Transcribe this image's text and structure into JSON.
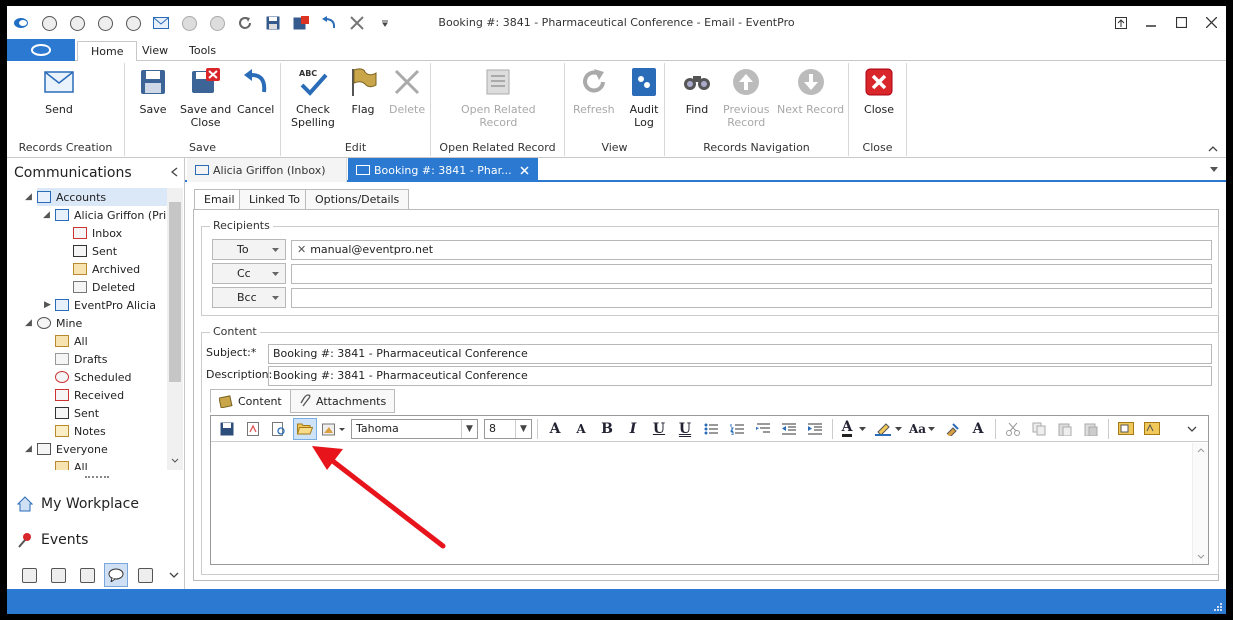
{
  "window": {
    "title": "Booking #: 3841 - Pharmaceutical Conference - Email - EventPro",
    "accent": "#2b79d0"
  },
  "qat": {
    "icons": [
      "back-icon",
      "clock-icon",
      "clock-icon",
      "clock-icon",
      "clock-icon",
      "envelope-icon",
      "up-circle-icon",
      "down-circle-icon",
      "refresh-icon",
      "save-icon",
      "save-close-icon",
      "undo-icon",
      "close-x-icon",
      "qat-dropdown-icon"
    ]
  },
  "ribbon_tabs": [
    "Home",
    "View",
    "Tools"
  ],
  "ribbon": {
    "groups": {
      "records_creation": "Records Creation",
      "save": "Save",
      "edit": "Edit",
      "open_related": "Open Related Record",
      "view": "View",
      "records_navigation": "Records Navigation",
      "close": "Close"
    },
    "buttons": {
      "send": "Send",
      "save": "Save",
      "save_close_1": "Save and",
      "save_close_2": "Close",
      "cancel": "Cancel",
      "check_1": "Check",
      "check_2": "Spelling",
      "flag": "Flag",
      "delete": "Delete",
      "open_related_1": "Open Related",
      "open_related_2": "Record",
      "refresh": "Refresh",
      "audit_1": "Audit",
      "audit_2": "Log",
      "find": "Find",
      "prev_1": "Previous",
      "prev_2": "Record",
      "next": "Next Record",
      "close": "Close"
    }
  },
  "sidebar": {
    "title": "Communications",
    "tree": {
      "accounts": "Accounts",
      "alicia_account": "Alicia Griffon (Pri...",
      "inbox": "Inbox",
      "sent": "Sent",
      "archived": "Archived",
      "deleted": "Deleted",
      "eventpro_alicia": "EventPro Alicia",
      "mine": "Mine",
      "mine_all": "All",
      "drafts": "Drafts",
      "scheduled": "Scheduled",
      "received": "Received",
      "mine_sent": "Sent",
      "notes": "Notes",
      "everyone": "Everyone",
      "everyone_all": "All"
    },
    "nav": {
      "workplace": "My Workplace",
      "events": "Events"
    }
  },
  "doc_tabs": {
    "inbox": "Alicia Griffon (Inbox)",
    "booking": "Booking #: 3841 - Phar..."
  },
  "form_tabs": [
    "Email",
    "Linked To",
    "Options/Details"
  ],
  "recipients": {
    "legend": "Recipients",
    "to_label": "To",
    "cc_label": "Cc",
    "bcc_label": "Bcc",
    "to_value": "manual@eventpro.net",
    "cc_value": "",
    "bcc_value": ""
  },
  "content": {
    "legend": "Content",
    "subject_label": "Subject:*",
    "subject_value": "Booking #: 3841 - Pharmaceutical Conference",
    "description_label": "Description:",
    "description_value": "Booking #: 3841 - Pharmaceutical Conference",
    "tabs": [
      "Content",
      "Attachments"
    ]
  },
  "editor": {
    "font": "Tahoma",
    "size": "8",
    "bold": "B",
    "italic": "I",
    "underline": "U",
    "double_underline": "U",
    "grow_font": "A",
    "shrink_font": "A",
    "font_color": "A",
    "case": "Aa",
    "clear_format": "A",
    "highlighted_tool": "open-file-icon",
    "annotation_color": "#e8141c"
  }
}
